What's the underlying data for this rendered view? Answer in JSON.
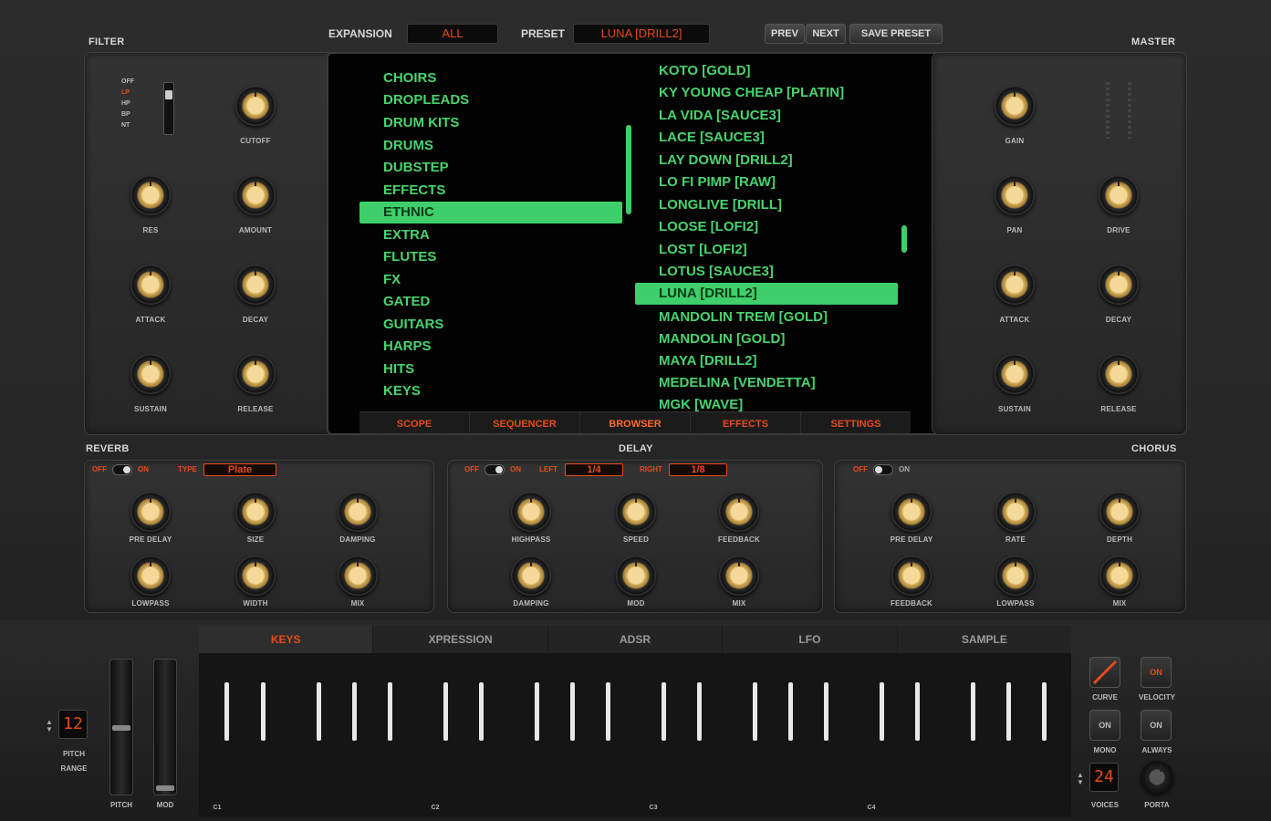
{
  "header": {
    "expansion_label": "EXPANSION",
    "expansion_value": "ALL",
    "preset_label": "PRESET",
    "preset_value": "LUNA [DRILL2]",
    "prev_label": "PREV",
    "next_label": "NEXT",
    "save_label": "SAVE PRESET"
  },
  "filter": {
    "title": "FILTER",
    "modes": [
      "OFF",
      "LP",
      "HP",
      "BP",
      "NT"
    ],
    "knobs": [
      "CUTOFF",
      "RES",
      "AMOUNT",
      "ATTACK",
      "DECAY",
      "SUSTAIN",
      "RELEASE"
    ]
  },
  "master": {
    "title": "MASTER",
    "knobs": [
      "GAIN",
      "PAN",
      "DRIVE",
      "ATTACK",
      "DECAY",
      "SUSTAIN",
      "RELEASE"
    ]
  },
  "browser": {
    "categories": [
      "CHOIRS",
      "DROPLEADS",
      "DRUM KITS",
      "DRUMS",
      "DUBSTEP",
      "EFFECTS",
      "ETHNIC",
      "EXTRA",
      "FLUTES",
      "FX",
      "GATED",
      "GUITARS",
      "HARPS",
      "HITS",
      "KEYS"
    ],
    "selected_category": "ETHNIC",
    "presets": [
      "KOTO [GOLD]",
      "KY YOUNG CHEAP [PLATIN]",
      "LA VIDA [SAUCE3]",
      "LACE [SAUCE3]",
      "LAY DOWN [DRILL2]",
      "LO FI PIMP [RAW]",
      "LONGLIVE [DRILL]",
      "LOOSE [LOFI2]",
      "LOST [LOFI2]",
      "LOTUS [SAUCE3]",
      "LUNA [DRILL2]",
      "MANDOLIN TREM [GOLD]",
      "MANDOLIN [GOLD]",
      "MAYA [DRILL2]",
      "MEDELINA [VENDETTA]",
      "MGK [WAVE]"
    ],
    "selected_preset": "LUNA [DRILL2]",
    "tabs": [
      "SCOPE",
      "SEQUENCER",
      "BROWSER",
      "EFFECTS",
      "SETTINGS"
    ],
    "active_tab": "BROWSER"
  },
  "reverb": {
    "title": "REVERB",
    "off": "OFF",
    "on": "ON",
    "type_label": "TYPE",
    "type_value": "Plate",
    "knobs": [
      "PRE DELAY",
      "SIZE",
      "DAMPING",
      "LOWPASS",
      "WIDTH",
      "MIX"
    ]
  },
  "delay": {
    "title": "DELAY",
    "off": "OFF",
    "on": "ON",
    "left_label": "LEFT",
    "left_value": "1/4",
    "right_label": "RIGHT",
    "right_value": "1/8",
    "knobs": [
      "HIGHPASS",
      "SPEED",
      "FEEDBACK",
      "DAMPING",
      "MOD",
      "MIX"
    ]
  },
  "chorus": {
    "title": "CHORUS",
    "off": "OFF",
    "on": "ON",
    "knobs": [
      "PRE DELAY",
      "RATE",
      "DEPTH",
      "FEEDBACK",
      "LOWPASS",
      "MIX"
    ]
  },
  "bottom": {
    "tabs": [
      "KEYS",
      "XPRESSION",
      "ADSR",
      "LFO",
      "SAMPLE"
    ],
    "active_tab": "KEYS",
    "pitch_range_value": "12",
    "pitch_range_label_1": "PITCH",
    "pitch_range_label_2": "RANGE",
    "pitch_label": "PITCH",
    "mod_label": "MOD",
    "octaves": [
      "C1",
      "C2",
      "C3",
      "C4"
    ],
    "curve_label": "CURVE",
    "velocity_label": "VELOCITY",
    "velocity_value": "ON",
    "mono_label": "MONO",
    "mono_value": "ON",
    "always_label": "ALWAYS",
    "always_value": "ON",
    "voices_value": "24",
    "voices_label": "VOICES",
    "porta_label": "PORTA"
  },
  "colors": {
    "accent": "#e84b1a",
    "screen_green": "#49d36e",
    "knob_gold": "#d6b05c"
  }
}
